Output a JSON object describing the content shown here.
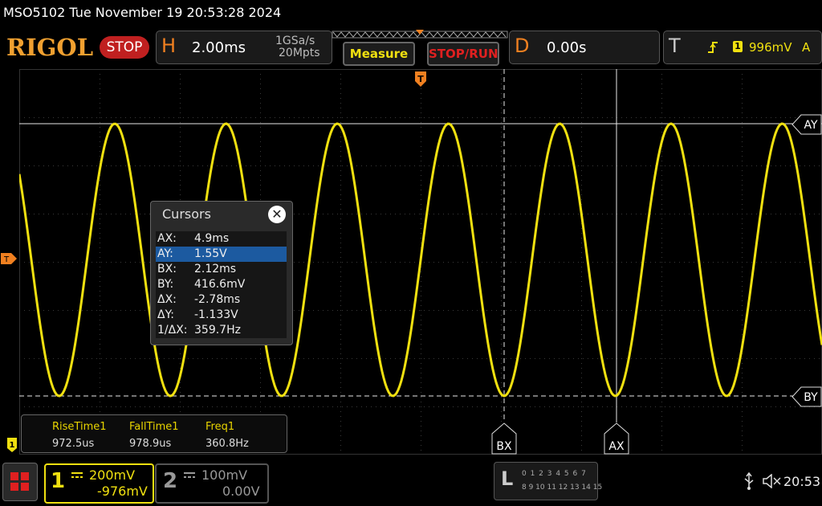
{
  "titlebar": {
    "text": "MSO5102  Tue November 19 20:53:28 2024"
  },
  "toolbar": {
    "logo": "RIGOL",
    "run_state": "STOP",
    "horizontal": {
      "letter": "H",
      "timebase": "2.00ms",
      "sample_rate": "1GSa/s",
      "memory_depth": "20Mpts"
    },
    "measure_label": "Measure",
    "stoprun_label": "STOP/RUN",
    "delay": {
      "letter": "D",
      "value": "0.00s"
    },
    "trigger": {
      "letter": "T",
      "channel": "1",
      "level": "996mV",
      "mode": "A"
    }
  },
  "cursors": {
    "title": "Cursors",
    "rows": [
      {
        "key": "AX:",
        "value": "4.9ms"
      },
      {
        "key": "AY:",
        "value": "1.55V"
      },
      {
        "key": "BX:",
        "value": "2.12ms"
      },
      {
        "key": "BY:",
        "value": "416.6mV"
      },
      {
        "key": "ΔX:",
        "value": "-2.78ms"
      },
      {
        "key": "ΔY:",
        "value": "-1.133V"
      },
      {
        "key": "1/ΔX:",
        "value": "359.7Hz"
      }
    ],
    "selected_index": 1
  },
  "cursor_tags": {
    "ay": "AY",
    "by": "BY",
    "ax": "AX",
    "bx": "BX"
  },
  "measurements": [
    {
      "label": "RiseTime1",
      "value": "972.5us"
    },
    {
      "label": "FallTime1",
      "value": "978.9us"
    },
    {
      "label": "Freq1",
      "value": "360.8Hz"
    }
  ],
  "markers": {
    "trigger_marker": "T",
    "ch1_marker": "1"
  },
  "channel1": {
    "number": "1",
    "scale": "200mV",
    "offset": "-976mV"
  },
  "channel2": {
    "number": "2",
    "scale": "100mV",
    "offset": "0.00V"
  },
  "logic": {
    "letter": "L",
    "row1": "0 1 2 3  4 5 6 7",
    "row2": "8 9 10 11 12 13 14 15"
  },
  "status": {
    "time": "20:53"
  },
  "colors": {
    "ch1": "#f0e010",
    "accent": "#f08020",
    "stop": "#c02020",
    "selected": "#1c5aa0"
  },
  "waveform": {
    "frequency_hz": 360.8,
    "high_v": 1.55,
    "low_v": 0.4166,
    "volts_per_div": 0.2,
    "ms_per_div": 2.0
  }
}
